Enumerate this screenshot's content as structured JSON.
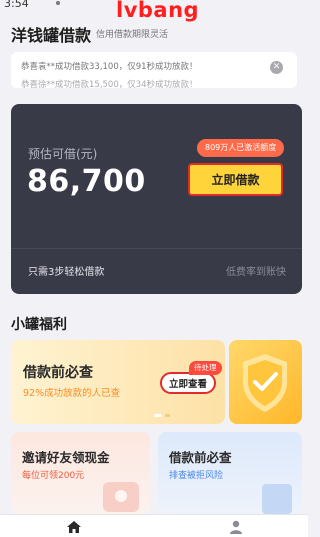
{
  "status_bar": {
    "time": "3:54"
  },
  "watermark": "lvbang",
  "header": {
    "title": "洋钱罐借款",
    "subtitle": "信用借款期限灵活"
  },
  "notice": {
    "line1": "恭喜袁**成功借款33,100，仅91秒成功放款！",
    "line2": "恭喜徐**成功借款15,500，仅34秒成功放款！",
    "close_icon": "close-icon"
  },
  "loan_card": {
    "label": "预估可借(元)",
    "amount": "86,700",
    "users_badge": "809万人已激活额度",
    "borrow_button": "立即借款",
    "footer_left": "只需3步轻松借款",
    "footer_right": "低费率到账快"
  },
  "benefits": {
    "section_title": "小罐福利",
    "banner": {
      "title": "借款前必查",
      "subtitle": "92%成功放款的人已查",
      "pending_badge": "待处理",
      "view_button": "立即查看"
    },
    "invite": {
      "title": "邀请好友领现金",
      "subtitle": "每位可领200元"
    },
    "precheck": {
      "title": "借款前必查",
      "subtitle": "排查被拒风险"
    }
  },
  "bottom_nav": {
    "home_icon": "home-icon",
    "profile_icon": "profile-icon"
  },
  "colors": {
    "accent_yellow": "#ffd43b",
    "card_dark": "#393a48",
    "highlight_red": "#e22c2c",
    "badge_red": "#ff6a4a"
  }
}
